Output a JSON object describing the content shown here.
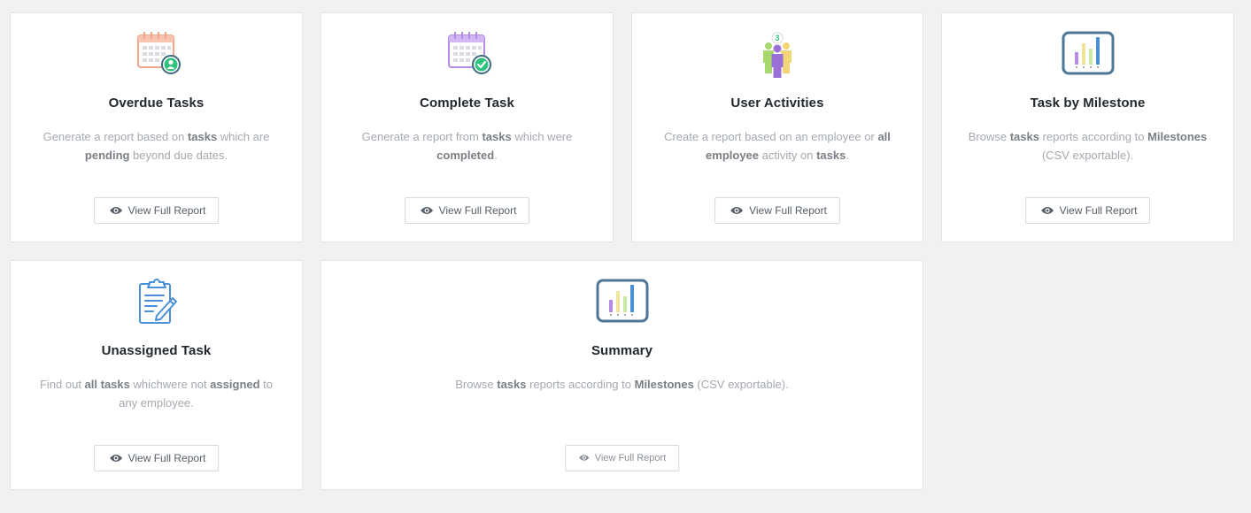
{
  "colors": {
    "background": "#f1f1f1",
    "card": "#ffffff",
    "title": "#23282d",
    "description": "#a4a9b0",
    "description_bold": "#7a7f86",
    "button_text": "#555d66"
  },
  "cards": [
    {
      "icon": "calendar-user-icon",
      "title": "Overdue Tasks",
      "desc": [
        "Generate a report based on ",
        "tasks",
        " which are ",
        "pending",
        " beyond due dates."
      ],
      "button": "View Full Report"
    },
    {
      "icon": "calendar-check-icon",
      "title": "Complete Task",
      "desc": [
        "Generate a report from ",
        "tasks",
        " which were ",
        "completed",
        "."
      ],
      "button": "View Full Report"
    },
    {
      "icon": "users-group-icon",
      "title": "User Activities",
      "desc": [
        "Create a report based on an employee or ",
        "all employee",
        " activity on ",
        "tasks",
        "."
      ],
      "button": "View Full Report"
    },
    {
      "icon": "milestone-chart-icon",
      "title": "Task by Milestone",
      "desc": [
        "Browse ",
        "tasks",
        " reports according to ",
        "Milestones",
        " (CSV exportable)."
      ],
      "button": "View Full Report"
    },
    {
      "icon": "clipboard-pen-icon",
      "title": "Unassigned Task",
      "desc": [
        "Find out ",
        "all tasks",
        " whichwere not ",
        "assigned",
        " to any employee."
      ],
      "button": "View Full Report"
    },
    {
      "icon": "milestone-chart-icon",
      "title": "Summary",
      "desc": [
        "Browse ",
        "tasks",
        " reports according to ",
        "Milestones",
        " (CSV exportable)."
      ],
      "button": "View Full Report"
    }
  ]
}
